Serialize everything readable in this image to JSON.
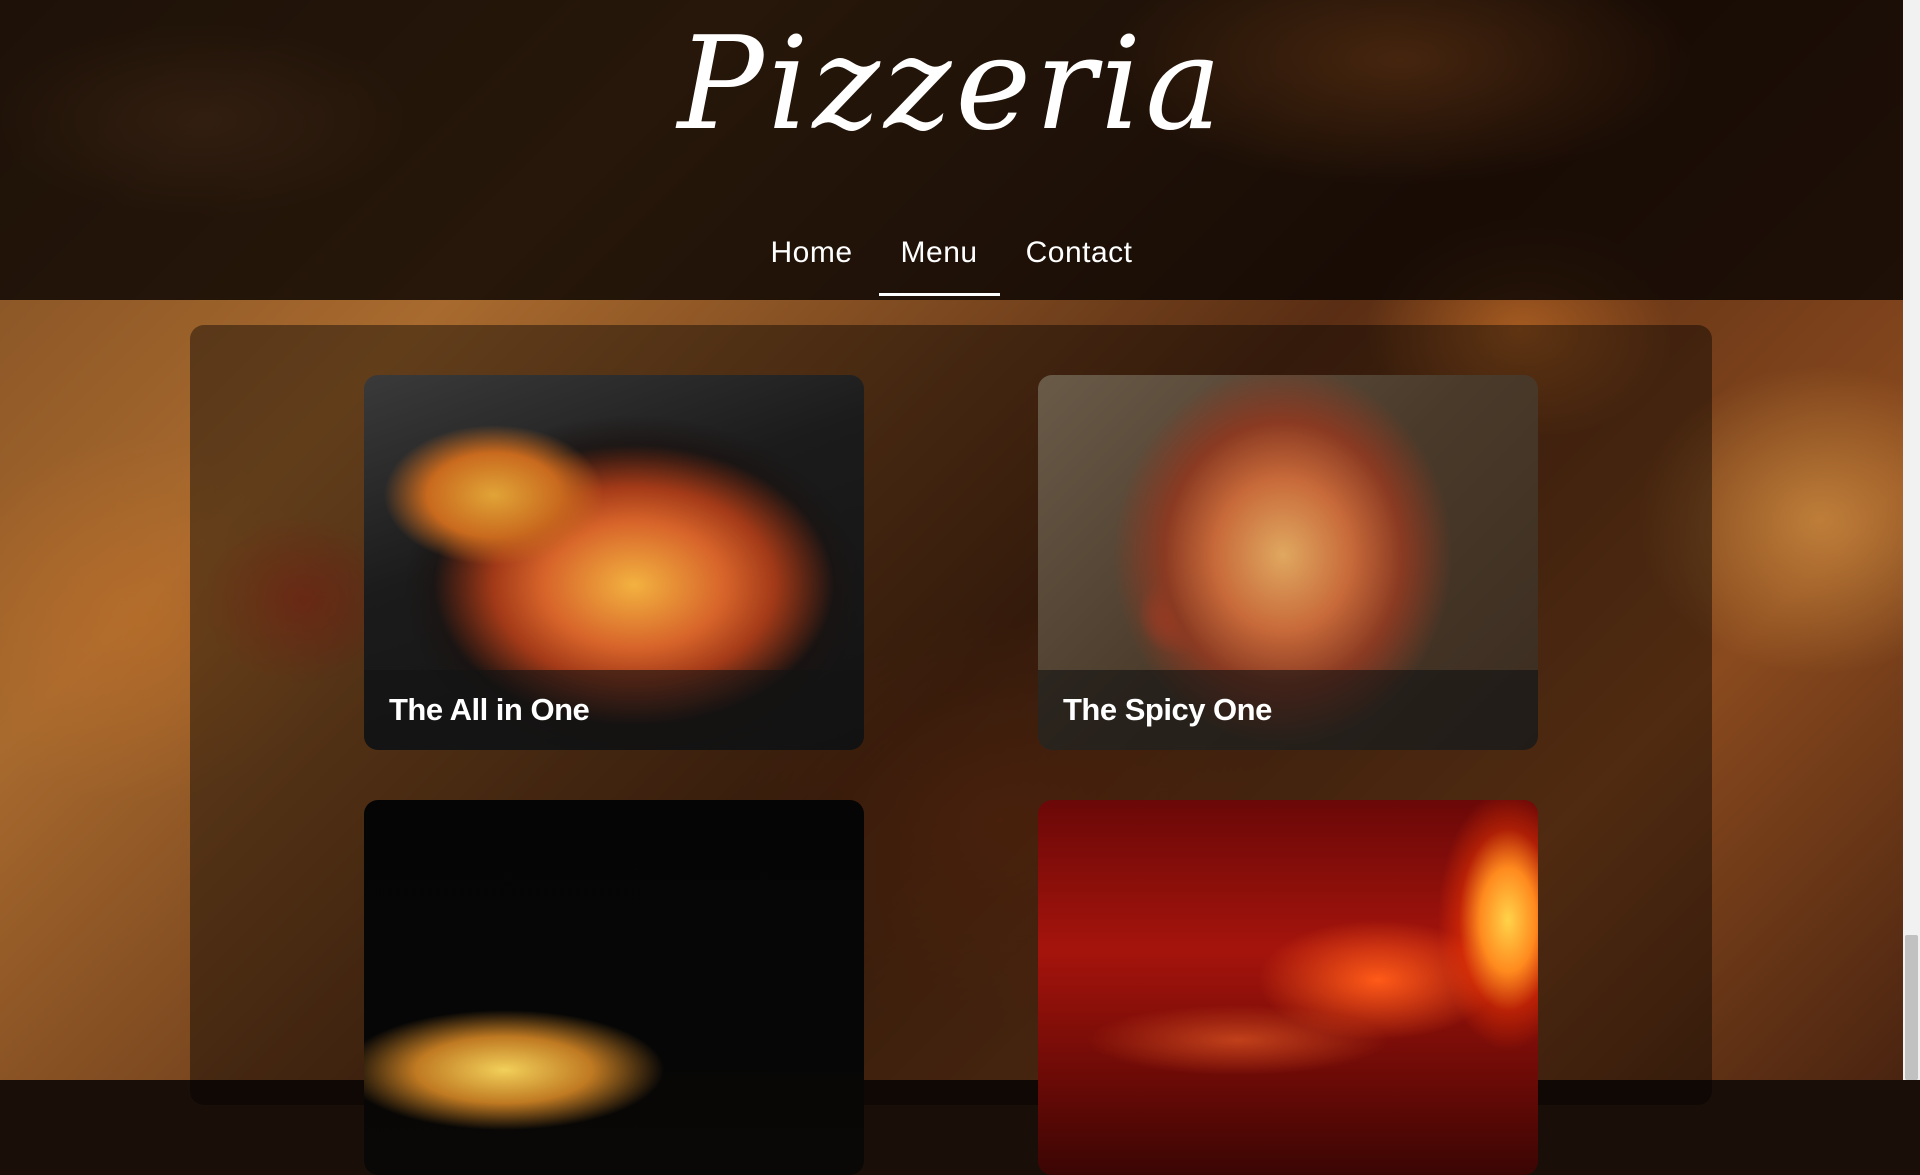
{
  "brand": {
    "title": "Pizzeria"
  },
  "nav": {
    "items": [
      {
        "label": "Home",
        "active": false
      },
      {
        "label": "Menu",
        "active": true
      },
      {
        "label": "Contact",
        "active": false
      }
    ]
  },
  "menu": {
    "cards": [
      {
        "caption": "The All in One",
        "image": "pizza-slice-lift-photo"
      },
      {
        "caption": "The Spicy One",
        "image": "sliced-pizza-topdown-photo"
      },
      {
        "caption": "",
        "image": "pizza-slice-dark-photo"
      },
      {
        "caption": "",
        "image": "wood-fired-oven-photo"
      }
    ]
  },
  "colors": {
    "nav_text": "#ffffff",
    "active_underline": "#ffffff",
    "header_bg": "#0a0503",
    "caption_bar": "#141414"
  }
}
